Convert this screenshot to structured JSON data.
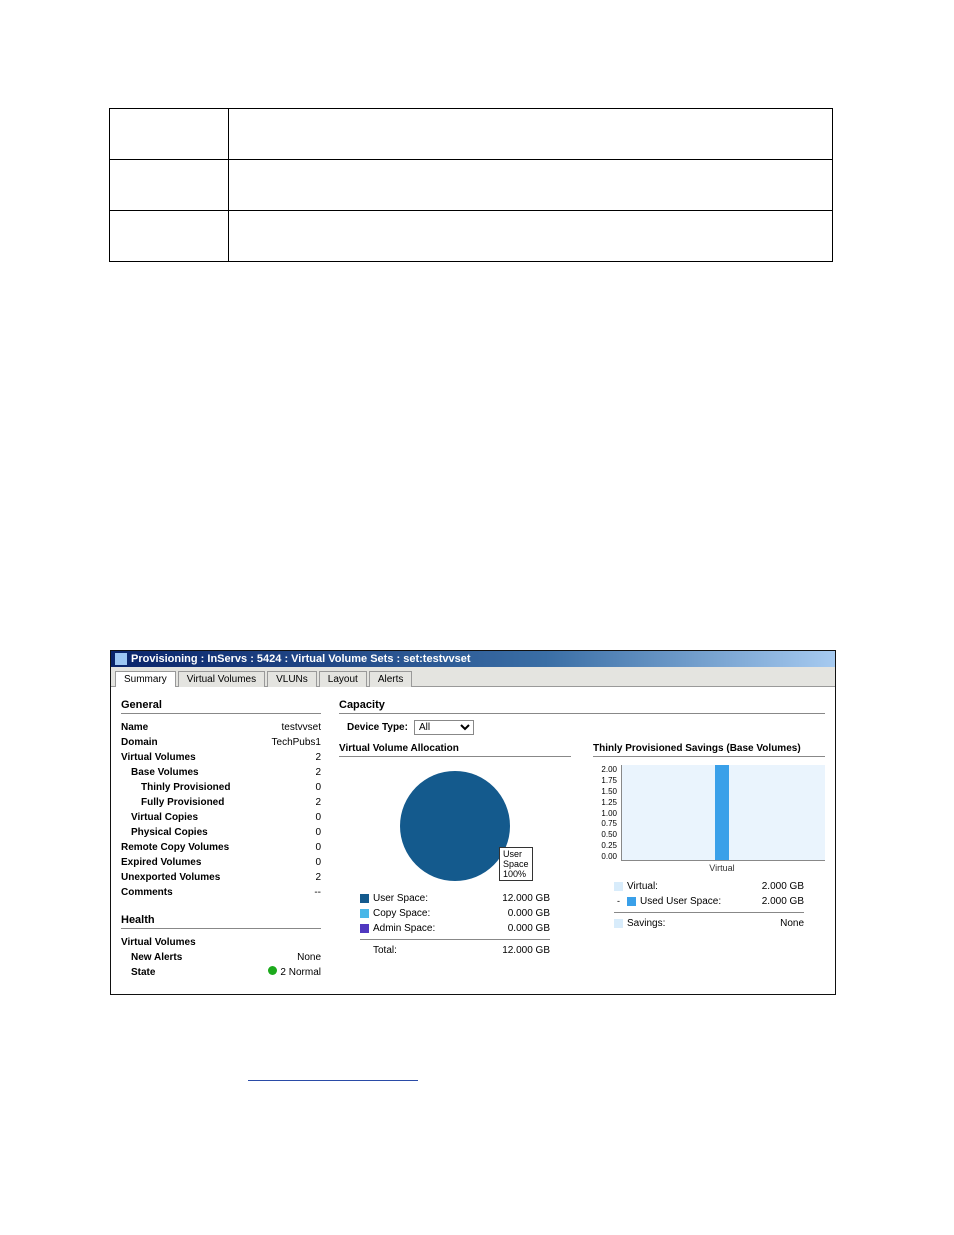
{
  "titlebar": {
    "text": "Provisioning : InServs : 5424 : Virtual Volume Sets : set:testvvset"
  },
  "tabs": {
    "summary": "Summary",
    "virtual_volumes": "Virtual Volumes",
    "vluns": "VLUNs",
    "layout": "Layout",
    "alerts": "Alerts"
  },
  "general": {
    "title": "General",
    "name_label": "Name",
    "name_value": "testvvset",
    "domain_label": "Domain",
    "domain_value": "TechPubs1",
    "vv_label": "Virtual Volumes",
    "vv_value": "2",
    "base_label": "Base Volumes",
    "base_value": "2",
    "thin_label": "Thinly Provisioned",
    "thin_value": "0",
    "full_label": "Fully Provisioned",
    "full_value": "2",
    "vc_label": "Virtual Copies",
    "vc_value": "0",
    "pc_label": "Physical Copies",
    "pc_value": "0",
    "rc_label": "Remote Copy Volumes",
    "rc_value": "0",
    "exp_label": "Expired Volumes",
    "exp_value": "0",
    "unexp_label": "Unexported Volumes",
    "unexp_value": "2",
    "comments_label": "Comments",
    "comments_value": "--"
  },
  "health": {
    "title": "Health",
    "vv_title": "Virtual Volumes",
    "new_alerts_label": "New Alerts",
    "new_alerts_value": "None",
    "state_label": "State",
    "state_value": "2 Normal"
  },
  "capacity": {
    "title": "Capacity",
    "device_type_label": "Device Type:",
    "device_type_value": "All",
    "vva": {
      "title": "Virtual Volume Allocation",
      "pie_label": "User\nSpace\n100%",
      "user_space_label": "User Space:",
      "user_space_value": "12.000 GB",
      "copy_space_label": "Copy Space:",
      "copy_space_value": "0.000 GB",
      "admin_space_label": "Admin Space:",
      "admin_space_value": "0.000 GB",
      "total_label": "Total:",
      "total_value": "12.000 GB"
    },
    "thin": {
      "title": "Thinly Provisioned Savings (Base Volumes)",
      "y_ticks": [
        "2.00",
        "1.75",
        "1.50",
        "1.25",
        "1.00",
        "0.75",
        "0.50",
        "0.25",
        "0.00"
      ],
      "x_label": "Virtual",
      "virtual_label": "Virtual:",
      "virtual_value": "2.000 GB",
      "used_label": "Used User Space:",
      "used_value": "2.000 GB",
      "savings_label": "Savings:",
      "savings_value": "None"
    }
  },
  "colors": {
    "user_space": "#145a8d",
    "copy_space": "#49b7e8",
    "admin_space": "#5038c0",
    "bar": "#3aa0e9",
    "area": "#d8ecfb"
  },
  "chart_data": [
    {
      "type": "pie",
      "title": "Virtual Volume Allocation",
      "series": [
        {
          "name": "User Space",
          "value": 12.0,
          "unit": "GB",
          "percent": 100
        },
        {
          "name": "Copy Space",
          "value": 0.0,
          "unit": "GB",
          "percent": 0
        },
        {
          "name": "Admin Space",
          "value": 0.0,
          "unit": "GB",
          "percent": 0
        }
      ],
      "total": 12.0
    },
    {
      "type": "bar",
      "title": "Thinly Provisioned Savings (Base Volumes)",
      "xlabel": "",
      "ylabel": "",
      "ylim": [
        0,
        2.0
      ],
      "categories": [
        "Virtual"
      ],
      "series": [
        {
          "name": "Virtual",
          "values": [
            2.0
          ]
        },
        {
          "name": "Used User Space",
          "values": [
            2.0
          ]
        }
      ],
      "annotations": {
        "Savings": "None"
      }
    }
  ]
}
